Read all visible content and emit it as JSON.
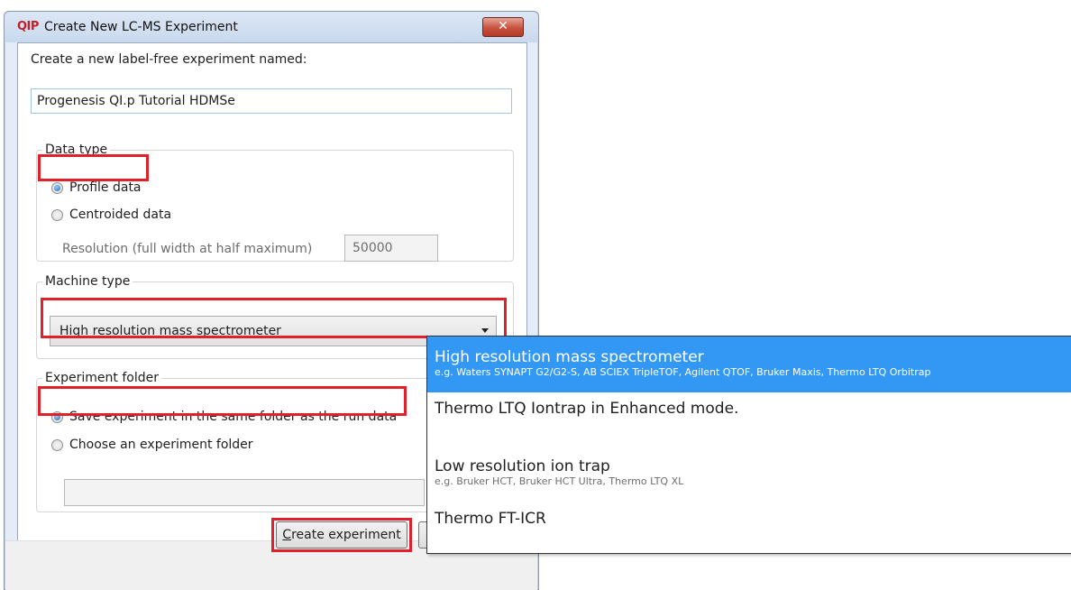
{
  "window": {
    "app_icon": "QIP",
    "title": "Create New LC-MS Experiment",
    "close_symbol": "✕"
  },
  "name_section": {
    "label": "Create a new label-free experiment named:",
    "value": "Progenesis QI.p Tutorial HDMSe"
  },
  "data_type": {
    "legend": "Data type",
    "options": [
      {
        "label": "Profile data",
        "checked": true
      },
      {
        "label": "Centroided data",
        "checked": false
      }
    ],
    "resolution_label": "Resolution (full width at half maximum)",
    "resolution_value": "50000"
  },
  "machine_type": {
    "legend": "Machine type",
    "selected": "High resolution mass spectrometer"
  },
  "experiment_folder": {
    "legend": "Experiment folder",
    "options": [
      {
        "label": "Save experiment in the same folder as the run data",
        "checked": true
      },
      {
        "label": "Choose an experiment folder",
        "checked": false
      }
    ]
  },
  "buttons": {
    "create_underlined": "C",
    "create_rest": "reate experiment"
  },
  "dropdown": {
    "options": [
      {
        "title": "High resolution mass spectrometer",
        "subtitle": "e.g. Waters SYNAPT G2/G2-S, AB SCIEX TripleTOF, Agilent QTOF, Bruker Maxis, Thermo LTQ Orbitrap"
      },
      {
        "title": "Thermo LTQ Iontrap in Enhanced mode.",
        "subtitle": ""
      },
      {
        "title": "Low resolution ion trap",
        "subtitle": "e.g. Bruker HCT, Bruker HCT Ultra, Thermo LTQ XL"
      },
      {
        "title": "Thermo FT-ICR",
        "subtitle": ""
      }
    ]
  },
  "colors": {
    "highlight": "#e0202a",
    "selection": "#3398f3",
    "title_gradient": "#c9d9ee"
  }
}
